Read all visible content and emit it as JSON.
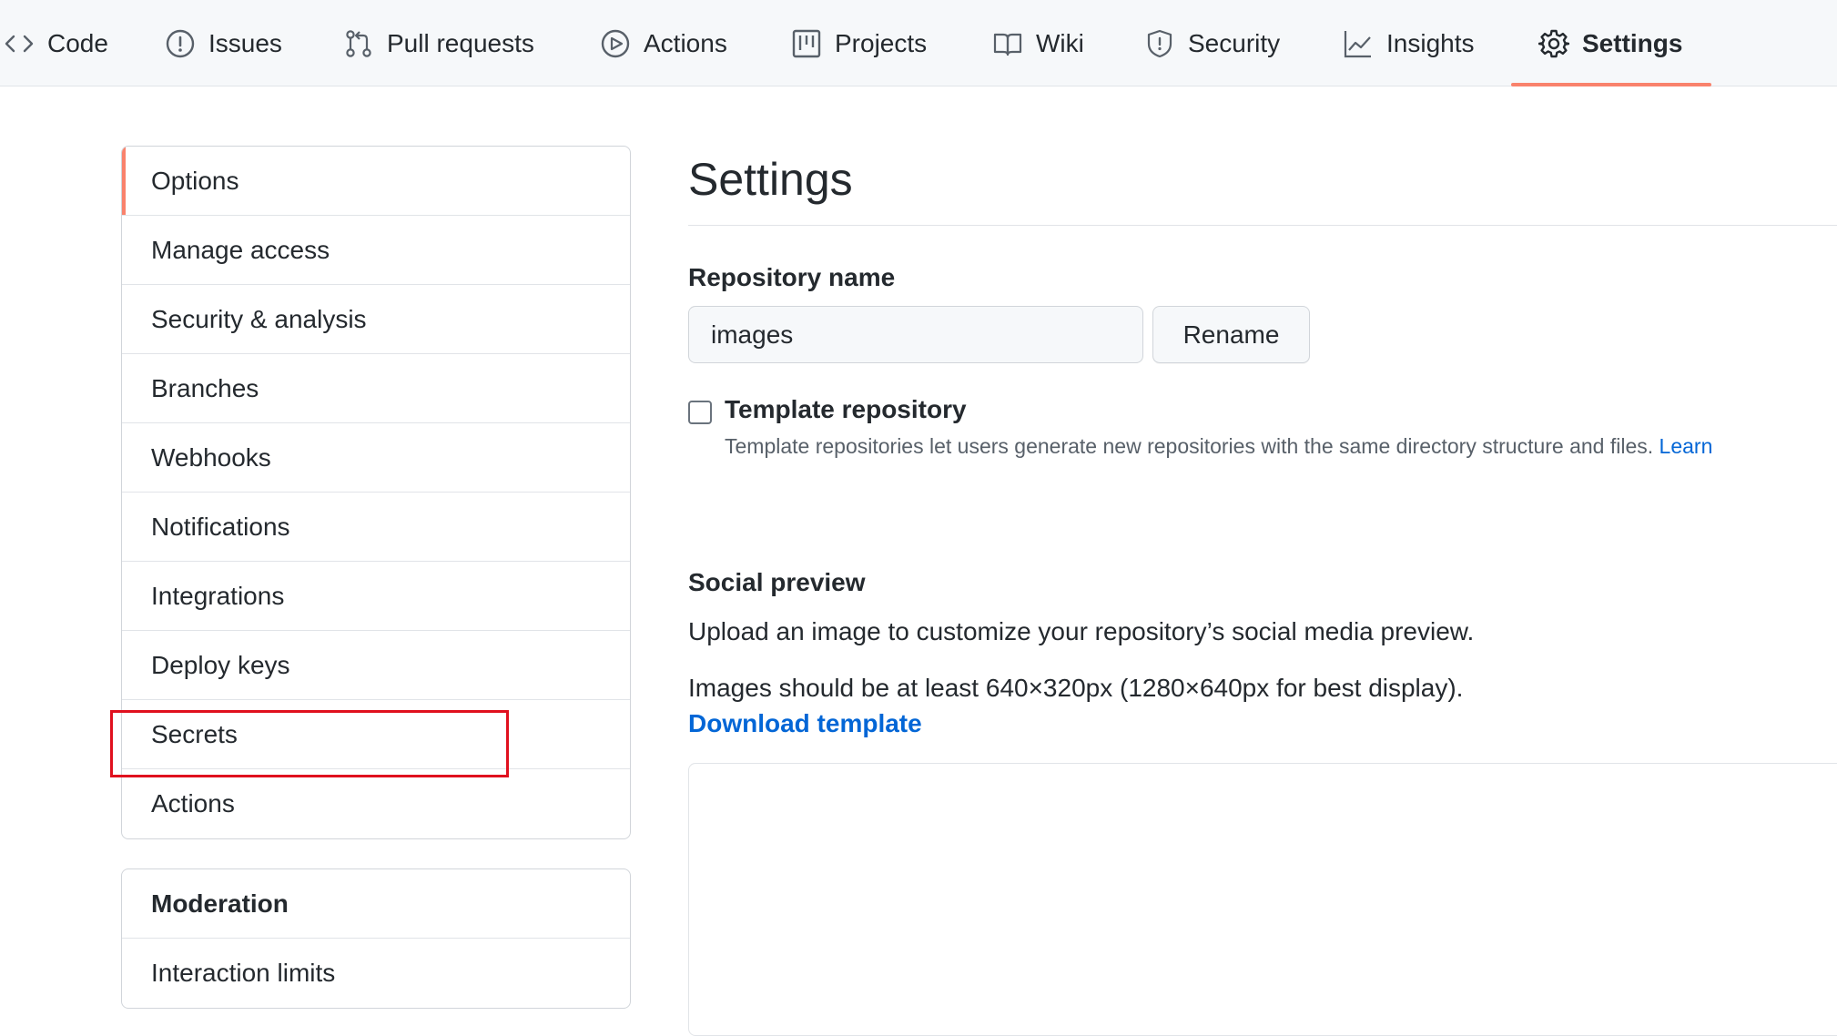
{
  "nav": {
    "tabs": [
      {
        "label": "Code",
        "icon": "code-icon"
      },
      {
        "label": "Issues",
        "icon": "issue-icon"
      },
      {
        "label": "Pull requests",
        "icon": "pull-request-icon"
      },
      {
        "label": "Actions",
        "icon": "play-icon"
      },
      {
        "label": "Projects",
        "icon": "project-icon"
      },
      {
        "label": "Wiki",
        "icon": "book-icon"
      },
      {
        "label": "Security",
        "icon": "shield-icon"
      },
      {
        "label": "Insights",
        "icon": "graph-icon"
      },
      {
        "label": "Settings",
        "icon": "gear-icon"
      }
    ],
    "selected": "Settings",
    "accent_color": "#f9826c"
  },
  "sidebar": {
    "items": [
      {
        "label": "Options"
      },
      {
        "label": "Manage access"
      },
      {
        "label": "Security & analysis"
      },
      {
        "label": "Branches"
      },
      {
        "label": "Webhooks"
      },
      {
        "label": "Notifications"
      },
      {
        "label": "Integrations"
      },
      {
        "label": "Deploy keys"
      },
      {
        "label": "Secrets"
      },
      {
        "label": "Actions"
      }
    ],
    "selected": "Options",
    "highlighted": "Secrets",
    "highlight_color": "#e0101e",
    "moderation": {
      "heading": "Moderation",
      "items": [
        {
          "label": "Interaction limits"
        }
      ]
    }
  },
  "main": {
    "title": "Settings",
    "repo_name": {
      "label": "Repository name",
      "value": "images",
      "button": "Rename"
    },
    "template": {
      "label": "Template repository",
      "checked": false,
      "description": "Template repositories let users generate new repositories with the same directory structure and files.",
      "link": "Learn"
    },
    "social_preview": {
      "heading": "Social preview",
      "line1": "Upload an image to customize your repository’s social media preview.",
      "line2": "Images should be at least 640×320px (1280×640px for best display).",
      "link": "Download template"
    },
    "link_color": "#0366d6"
  }
}
